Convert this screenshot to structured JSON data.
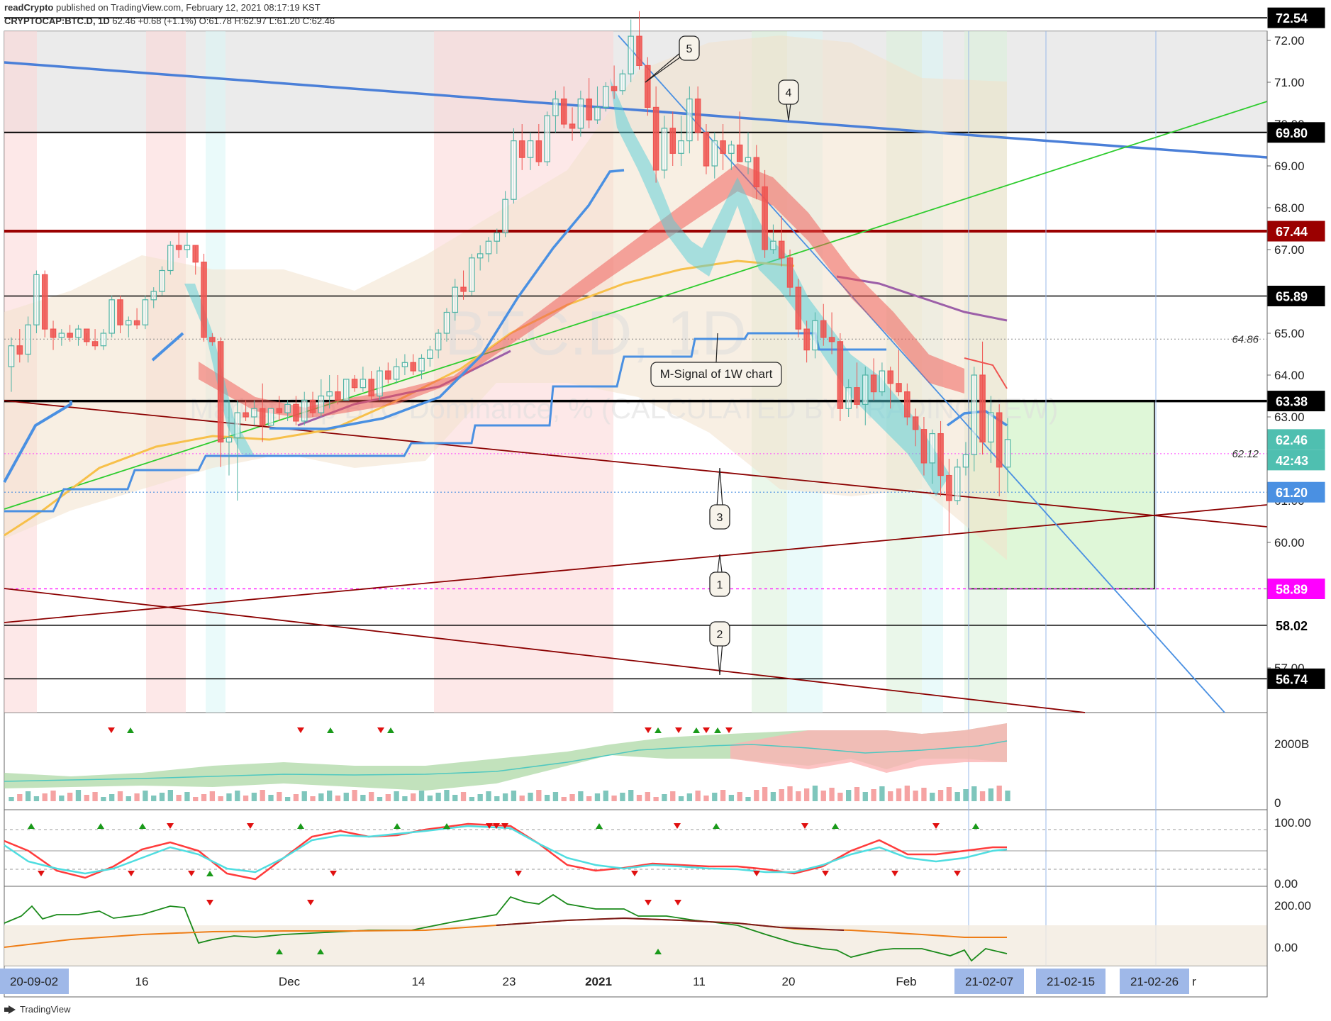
{
  "header": {
    "author": "readCrypto",
    "published_text": "published on TradingView.com, February 12, 2021 08:17:19 KST",
    "symbol": "CRYPTOCAP:BTC.D, 1D",
    "price": "62.46",
    "change": "+0.68 (+1.1%)",
    "ohlc": "O:61.78 H:62.97 L:61.20 C:62.46"
  },
  "watermark": {
    "title": "BTC.D, 1D",
    "subtitle": "Market Cap BTC Dominance, % (CALCULATED BY TRADINGVIEW)"
  },
  "footer": {
    "brand": "TradingView"
  },
  "chart_data": {
    "type": "candlestick",
    "price_axis": {
      "ticks": [
        "72.00",
        "71.00",
        "70.00",
        "69.00",
        "68.00",
        "67.00",
        "66.00",
        "65.00",
        "64.00",
        "63.00",
        "62.00",
        "61.00",
        "60.00",
        "59.00",
        "58.00",
        "57.00"
      ],
      "ylim": [
        56.74,
        72.54
      ]
    },
    "price_labels": [
      {
        "value": "72.54",
        "color": "#000000",
        "text_color": "#ffffff"
      },
      {
        "value": "69.80",
        "color": "#000000",
        "text_color": "#ffffff"
      },
      {
        "value": "67.44",
        "color": "#9b0000",
        "text_color": "#ffffff"
      },
      {
        "value": "65.89",
        "color": "#000000",
        "text_color": "#ffffff"
      },
      {
        "value": "63.38",
        "color": "#000000",
        "text_color": "#ffffff"
      },
      {
        "value": "62.46",
        "color": "#4fbfb0",
        "text_color": "#ffffff"
      },
      {
        "value": "42:43",
        "color": "#4fbfb0",
        "text_color": "#ffffff"
      },
      {
        "value": "61.20",
        "color": "#4a90e2",
        "text_color": "#ffffff"
      },
      {
        "value": "58.89",
        "color": "#ff00ff",
        "text_color": "#ffffff"
      },
      {
        "value": "58.02",
        "color": "#ffffff",
        "text_color": "#000000"
      },
      {
        "value": "56.74",
        "color": "#000000",
        "text_color": "#ffffff"
      }
    ],
    "dotted_levels": [
      "64.86",
      "62.12"
    ],
    "horizontal_levels": [
      72.54,
      69.8,
      67.44,
      65.89,
      63.38,
      58.02,
      56.74
    ],
    "target_box": {
      "top": 63.38,
      "bottom": 58.89
    },
    "callouts": [
      "5",
      "4",
      "3",
      "1",
      "2"
    ],
    "m_signal_label": "M-Signal of 1W chart",
    "x_ticks": [
      "20-09-02",
      "16",
      "Dec",
      "14",
      "23",
      "2021",
      "11",
      "20",
      "Feb",
      "21-02-07",
      "21-02-15",
      "21-02-26",
      "r"
    ],
    "x_tick_highlight": [
      "20-09-02",
      "21-02-07",
      "21-02-15",
      "21-02-26"
    ],
    "candles": [
      [
        64.2,
        64.9,
        63.6,
        64.7
      ],
      [
        64.7,
        65.1,
        64.3,
        64.5
      ],
      [
        64.5,
        65.4,
        64.3,
        65.2
      ],
      [
        65.2,
        66.5,
        65.0,
        66.4
      ],
      [
        66.4,
        66.5,
        64.9,
        65.1
      ],
      [
        65.1,
        65.3,
        64.6,
        64.9
      ],
      [
        64.9,
        65.1,
        64.7,
        65.0
      ],
      [
        65.0,
        65.2,
        64.8,
        64.9
      ],
      [
        64.9,
        65.2,
        64.7,
        65.1
      ],
      [
        65.1,
        65.0,
        64.7,
        64.8
      ],
      [
        64.8,
        65.1,
        64.6,
        64.7
      ],
      [
        64.7,
        65.1,
        64.6,
        65.0
      ],
      [
        65.0,
        65.9,
        64.9,
        65.8
      ],
      [
        65.8,
        65.9,
        65.0,
        65.2
      ],
      [
        65.2,
        65.4,
        64.9,
        65.3
      ],
      [
        65.3,
        65.6,
        65.1,
        65.2
      ],
      [
        65.2,
        65.9,
        65.1,
        65.8
      ],
      [
        65.8,
        66.1,
        65.6,
        66.0
      ],
      [
        66.0,
        66.6,
        65.9,
        66.5
      ],
      [
        66.5,
        67.2,
        66.4,
        67.1
      ],
      [
        67.1,
        67.4,
        66.8,
        67.0
      ],
      [
        67.0,
        67.4,
        66.8,
        67.1
      ],
      [
        67.1,
        67.1,
        66.4,
        66.7
      ],
      [
        66.7,
        66.9,
        64.8,
        64.9
      ],
      [
        64.9,
        65.0,
        64.7,
        64.8
      ],
      [
        64.8,
        64.9,
        61.8,
        62.4
      ],
      [
        62.4,
        63.4,
        61.6,
        62.5
      ],
      [
        62.5,
        63.4,
        61.0,
        63.1
      ],
      [
        63.1,
        63.4,
        62.9,
        63.0
      ],
      [
        63.0,
        63.4,
        62.8,
        63.2
      ],
      [
        63.2,
        63.8,
        62.4,
        62.8
      ],
      [
        62.8,
        63.1,
        62.8,
        63.2
      ],
      [
        63.2,
        63.5,
        62.9,
        63.1
      ],
      [
        63.1,
        63.4,
        62.9,
        63.3
      ],
      [
        63.3,
        63.5,
        62.8,
        62.9
      ],
      [
        62.9,
        63.6,
        62.8,
        63.4
      ],
      [
        63.4,
        63.6,
        63.0,
        63.1
      ],
      [
        63.1,
        63.9,
        63.0,
        63.5
      ],
      [
        63.5,
        64.0,
        63.2,
        63.6
      ],
      [
        63.6,
        64.0,
        63.3,
        63.4
      ],
      [
        63.4,
        63.9,
        63.4,
        63.9
      ],
      [
        63.9,
        64.0,
        63.6,
        63.7
      ],
      [
        63.7,
        64.2,
        63.6,
        63.9
      ],
      [
        63.9,
        64.1,
        63.4,
        63.5
      ],
      [
        63.5,
        64.2,
        63.4,
        64.1
      ],
      [
        64.1,
        64.3,
        63.8,
        63.9
      ],
      [
        63.9,
        64.4,
        63.8,
        64.2
      ],
      [
        64.2,
        64.5,
        64.0,
        64.3
      ],
      [
        64.3,
        64.5,
        64.0,
        64.1
      ],
      [
        64.1,
        64.5,
        63.9,
        64.4
      ],
      [
        64.4,
        64.7,
        64.2,
        64.6
      ],
      [
        64.6,
        65.1,
        64.4,
        65.0
      ],
      [
        65.0,
        65.6,
        64.8,
        65.5
      ],
      [
        65.5,
        66.3,
        65.3,
        66.1
      ],
      [
        66.1,
        66.5,
        65.8,
        66.0
      ],
      [
        66.0,
        66.9,
        65.9,
        66.8
      ],
      [
        66.8,
        67.1,
        66.5,
        66.9
      ],
      [
        66.9,
        67.3,
        66.7,
        67.2
      ],
      [
        67.2,
        67.5,
        66.9,
        67.4
      ],
      [
        67.4,
        68.4,
        67.3,
        68.2
      ],
      [
        68.2,
        69.9,
        68.1,
        69.6
      ],
      [
        69.6,
        70.0,
        68.9,
        69.2
      ],
      [
        69.2,
        69.8,
        68.9,
        69.6
      ],
      [
        69.6,
        70.0,
        69.0,
        69.1
      ],
      [
        69.1,
        70.3,
        69.0,
        70.2
      ],
      [
        70.2,
        70.8,
        69.8,
        70.6
      ],
      [
        70.6,
        70.9,
        69.9,
        70.0
      ],
      [
        70.0,
        70.4,
        69.6,
        69.9
      ],
      [
        69.9,
        70.8,
        69.7,
        70.6
      ],
      [
        70.6,
        71.1,
        69.9,
        70.1
      ],
      [
        70.1,
        70.9,
        70.0,
        70.4
      ],
      [
        70.4,
        71.0,
        70.3,
        70.9
      ],
      [
        70.9,
        71.4,
        70.6,
        70.8
      ],
      [
        70.8,
        71.3,
        70.7,
        71.2
      ],
      [
        71.2,
        72.5,
        71.0,
        72.1
      ],
      [
        72.1,
        72.7,
        71.3,
        71.4
      ],
      [
        71.4,
        71.6,
        70.2,
        70.4
      ],
      [
        70.4,
        70.9,
        68.6,
        68.9
      ],
      [
        68.9,
        70.2,
        68.7,
        69.9
      ],
      [
        69.9,
        70.3,
        69.0,
        69.3
      ],
      [
        69.3,
        70.2,
        69.0,
        69.6
      ],
      [
        69.6,
        70.9,
        69.3,
        70.6
      ],
      [
        70.6,
        70.9,
        69.6,
        69.8
      ],
      [
        69.8,
        70.0,
        68.8,
        69.0
      ],
      [
        69.0,
        69.8,
        68.7,
        69.6
      ],
      [
        69.6,
        70.0,
        68.9,
        69.3
      ],
      [
        69.3,
        69.6,
        68.9,
        69.5
      ],
      [
        69.5,
        70.3,
        69.1,
        69.1
      ],
      [
        69.1,
        69.8,
        68.8,
        69.2
      ],
      [
        69.2,
        69.5,
        68.2,
        68.5
      ],
      [
        68.5,
        68.9,
        66.8,
        67.0
      ],
      [
        67.0,
        67.6,
        66.9,
        67.2
      ],
      [
        67.2,
        67.8,
        66.6,
        66.8
      ],
      [
        66.8,
        67.0,
        65.9,
        66.1
      ],
      [
        66.1,
        66.3,
        64.9,
        65.1
      ],
      [
        65.1,
        65.3,
        64.3,
        64.6
      ],
      [
        64.6,
        65.5,
        64.4,
        65.3
      ],
      [
        65.3,
        65.7,
        64.7,
        64.9
      ],
      [
        64.9,
        65.5,
        64.5,
        64.8
      ],
      [
        64.8,
        65.0,
        62.9,
        63.2
      ],
      [
        63.2,
        63.9,
        63.0,
        63.7
      ],
      [
        63.7,
        64.3,
        63.2,
        63.3
      ],
      [
        63.3,
        64.2,
        62.8,
        64.0
      ],
      [
        64.0,
        64.4,
        63.4,
        63.6
      ],
      [
        63.6,
        64.3,
        63.5,
        64.1
      ],
      [
        64.1,
        64.2,
        63.2,
        63.8
      ],
      [
        63.8,
        64.6,
        63.5,
        63.6
      ],
      [
        63.6,
        63.8,
        62.8,
        63.0
      ],
      [
        63.0,
        63.2,
        62.3,
        62.7
      ],
      [
        62.7,
        63.0,
        61.6,
        61.9
      ],
      [
        61.9,
        62.7,
        61.4,
        62.6
      ],
      [
        62.6,
        62.9,
        61.1,
        61.6
      ],
      [
        61.6,
        62.0,
        60.2,
        61.0
      ],
      [
        61.0,
        62.0,
        60.9,
        61.8
      ],
      [
        61.8,
        62.4,
        61.6,
        62.1
      ],
      [
        62.1,
        64.2,
        61.7,
        64.0
      ],
      [
        64.0,
        64.8,
        62.1,
        62.4
      ],
      [
        62.4,
        63.5,
        61.9,
        63.1
      ],
      [
        63.1,
        63.3,
        61.1,
        61.8
      ],
      [
        61.8,
        62.97,
        61.2,
        62.46
      ]
    ],
    "volume_axis": {
      "ticks": [
        "2000B",
        "0"
      ]
    },
    "stoch_axis": {
      "ticks": [
        "100.00",
        "0.00"
      ]
    },
    "osc_axis": {
      "ticks": [
        "200.00",
        "0.00"
      ]
    }
  },
  "colors": {
    "up": "#4fb3a5",
    "down": "#ef5350",
    "ma_blue": "#4a90e2",
    "ma_yellow": "#f7c04a",
    "ma_purple": "#9c5fa8",
    "trend_green": "#2ecc2e",
    "trend_red": "#8b0000",
    "trend_blue": "#4a7fd8"
  }
}
